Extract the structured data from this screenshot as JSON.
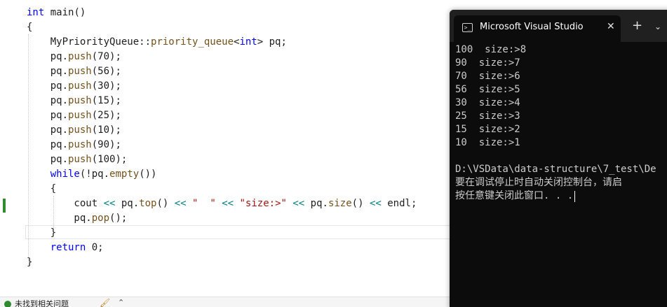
{
  "editor": {
    "lines": [
      {
        "id": "l1",
        "tokens": [
          {
            "c": "kw",
            "t": "int"
          },
          {
            "c": "tx",
            "t": " main()"
          }
        ]
      },
      {
        "id": "l2",
        "tokens": [
          {
            "c": "tx",
            "t": "{"
          }
        ]
      },
      {
        "id": "l3",
        "tokens": [
          {
            "c": "tx",
            "t": "    MyPriorityQueue::"
          },
          {
            "c": "fn",
            "t": "priority_queue"
          },
          {
            "c": "tx",
            "t": "<"
          },
          {
            "c": "kw",
            "t": "int"
          },
          {
            "c": "tx",
            "t": "> pq;"
          }
        ]
      },
      {
        "id": "l4",
        "tokens": [
          {
            "c": "tx",
            "t": "    pq."
          },
          {
            "c": "fn",
            "t": "push"
          },
          {
            "c": "tx",
            "t": "(70);"
          }
        ]
      },
      {
        "id": "l5",
        "tokens": [
          {
            "c": "tx",
            "t": "    pq."
          },
          {
            "c": "fn",
            "t": "push"
          },
          {
            "c": "tx",
            "t": "(56);"
          }
        ]
      },
      {
        "id": "l6",
        "tokens": [
          {
            "c": "tx",
            "t": "    pq."
          },
          {
            "c": "fn",
            "t": "push"
          },
          {
            "c": "tx",
            "t": "(30);"
          }
        ]
      },
      {
        "id": "l7",
        "tokens": [
          {
            "c": "tx",
            "t": "    pq."
          },
          {
            "c": "fn",
            "t": "push"
          },
          {
            "c": "tx",
            "t": "(15);"
          }
        ]
      },
      {
        "id": "l8",
        "tokens": [
          {
            "c": "tx",
            "t": "    pq."
          },
          {
            "c": "fn",
            "t": "push"
          },
          {
            "c": "tx",
            "t": "(25);"
          }
        ]
      },
      {
        "id": "l9",
        "tokens": [
          {
            "c": "tx",
            "t": "    pq."
          },
          {
            "c": "fn",
            "t": "push"
          },
          {
            "c": "tx",
            "t": "(10);"
          }
        ]
      },
      {
        "id": "l10",
        "tokens": [
          {
            "c": "tx",
            "t": "    pq."
          },
          {
            "c": "fn",
            "t": "push"
          },
          {
            "c": "tx",
            "t": "(90);"
          }
        ]
      },
      {
        "id": "l11",
        "tokens": [
          {
            "c": "tx",
            "t": "    pq."
          },
          {
            "c": "fn",
            "t": "push"
          },
          {
            "c": "tx",
            "t": "(100);"
          }
        ]
      },
      {
        "id": "l12",
        "tokens": [
          {
            "c": "tx",
            "t": "    "
          },
          {
            "c": "kw",
            "t": "while"
          },
          {
            "c": "tx",
            "t": "(!pq."
          },
          {
            "c": "fn",
            "t": "empty"
          },
          {
            "c": "tx",
            "t": "())"
          }
        ]
      },
      {
        "id": "l13",
        "tokens": [
          {
            "c": "tx",
            "t": "    {"
          }
        ]
      },
      {
        "id": "l14",
        "tokens": [
          {
            "c": "tx",
            "t": "        cout "
          },
          {
            "c": "op",
            "t": "<<"
          },
          {
            "c": "tx",
            "t": " pq."
          },
          {
            "c": "fn",
            "t": "top"
          },
          {
            "c": "tx",
            "t": "() "
          },
          {
            "c": "op",
            "t": "<<"
          },
          {
            "c": "tx",
            "t": " "
          },
          {
            "c": "st",
            "t": "\"  \""
          },
          {
            "c": "tx",
            "t": " "
          },
          {
            "c": "op",
            "t": "<<"
          },
          {
            "c": "tx",
            "t": " "
          },
          {
            "c": "st",
            "t": "\"size:>\""
          },
          {
            "c": "tx",
            "t": " "
          },
          {
            "c": "op",
            "t": "<<"
          },
          {
            "c": "tx",
            "t": " pq."
          },
          {
            "c": "fn",
            "t": "size"
          },
          {
            "c": "tx",
            "t": "() "
          },
          {
            "c": "op",
            "t": "<<"
          },
          {
            "c": "tx",
            "t": " endl;"
          }
        ]
      },
      {
        "id": "l15",
        "tokens": [
          {
            "c": "tx",
            "t": "        pq."
          },
          {
            "c": "fn",
            "t": "pop"
          },
          {
            "c": "tx",
            "t": "();"
          }
        ]
      },
      {
        "id": "l16",
        "tokens": [
          {
            "c": "tx",
            "t": "    }"
          }
        ]
      },
      {
        "id": "l17",
        "tokens": [
          {
            "c": "tx",
            "t": "    "
          },
          {
            "c": "kw",
            "t": "return"
          },
          {
            "c": "tx",
            "t": " 0;"
          }
        ]
      },
      {
        "id": "l18",
        "tokens": [
          {
            "c": "tx",
            "t": "}"
          }
        ]
      }
    ]
  },
  "statusbar": {
    "issues_text": "未找到相关问题",
    "brush_icon": "brush-icon",
    "chevron_icon": "chevron-up-icon"
  },
  "terminal": {
    "tab_title": "Microsoft Visual Studio 调试控制台",
    "tab_icon": "terminal-icon",
    "close_glyph": "✕",
    "new_tab_glyph": "+",
    "dropdown_glyph": "⌄",
    "output": [
      "100  size:>8",
      "90  size:>7",
      "70  size:>6",
      "56  size:>5",
      "30  size:>4",
      "25  size:>3",
      "15  size:>2",
      "10  size:>1",
      "",
      "D:\\VSData\\data-structure\\7_test\\De",
      "要在调试停止时自动关闭控制台，请启",
      "按任意键关闭此窗口. . ."
    ]
  },
  "colors": {
    "keyword": "#0000ff",
    "function": "#74531f",
    "string": "#a31515",
    "operator": "#008080",
    "terminal_bg": "#0c0c0c",
    "terminal_text": "#cccccc",
    "titlebar": "#202020"
  }
}
